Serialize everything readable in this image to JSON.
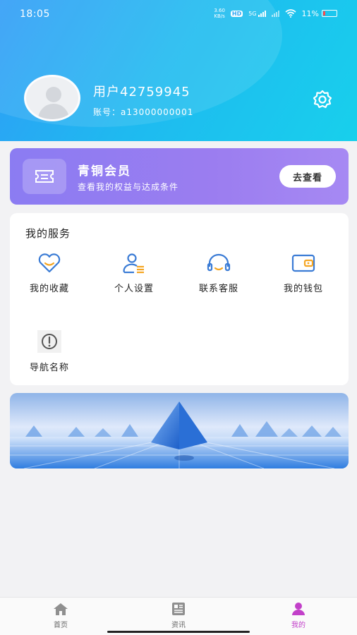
{
  "status": {
    "time": "18:05",
    "battery": "11%",
    "net_speed_top": "3.60",
    "net_speed_bottom": "KB/s",
    "hd": "HD",
    "network": "5G"
  },
  "profile": {
    "username": "用户42759945",
    "account": "账号：a13000000001"
  },
  "member": {
    "title": "青铜会员",
    "subtitle": "查看我的权益与达成条件",
    "button": "去查看"
  },
  "services": {
    "title": "我的服务",
    "items": [
      {
        "label": "我的收藏",
        "icon": "heart-icon"
      },
      {
        "label": "个人设置",
        "icon": "user-settings-icon"
      },
      {
        "label": "联系客服",
        "icon": "headset-icon"
      },
      {
        "label": "我的钱包",
        "icon": "wallet-icon"
      },
      {
        "label": "导航名称",
        "icon": "alert-circle-icon"
      }
    ]
  },
  "nav": {
    "items": [
      {
        "label": "首页",
        "icon": "home-icon",
        "active": false
      },
      {
        "label": "资讯",
        "icon": "news-icon",
        "active": false
      },
      {
        "label": "我的",
        "icon": "profile-icon",
        "active": true
      }
    ]
  },
  "colors": {
    "header_start": "#2f9cf6",
    "header_end": "#18d0ec",
    "member_bg": "#9b7df0",
    "icon_blue": "#3a7bd5",
    "accent_orange": "#f5a623",
    "nav_active": "#c240c9"
  }
}
